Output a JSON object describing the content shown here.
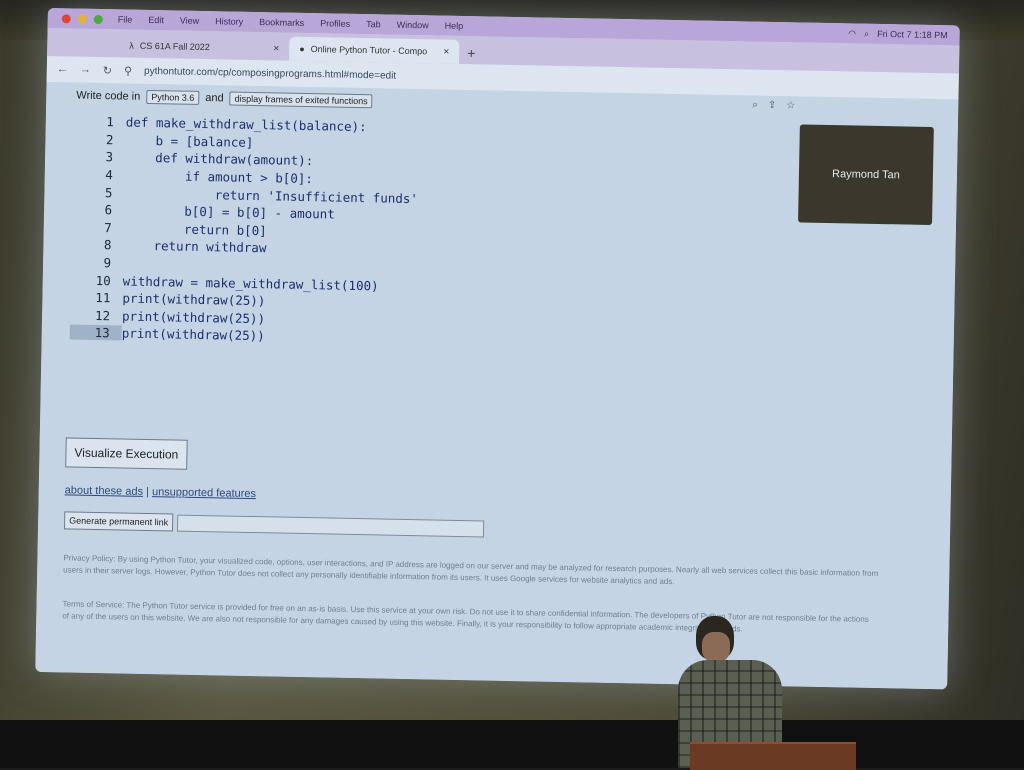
{
  "menubar": {
    "items": [
      "File",
      "Edit",
      "View",
      "History",
      "Bookmarks",
      "Profiles",
      "Tab",
      "Window",
      "Help"
    ],
    "clock": "Fri Oct 7 1:18 PM"
  },
  "tabs": [
    {
      "icon": "lambda-icon",
      "label": "CS 61A Fall 2022"
    },
    {
      "icon": "python-icon",
      "label": "Online Python Tutor - Compo"
    }
  ],
  "address": {
    "url": "pythontutor.com/cp/composingprograms.html#mode=edit"
  },
  "options": {
    "write_label": "Write code in",
    "language": "Python 3.6",
    "and_label": "and",
    "frames": "display frames of exited functions"
  },
  "code": {
    "current_line": 13,
    "lines": [
      "def make_withdraw_list(balance):",
      "    b = [balance]",
      "    def withdraw(amount):",
      "        if amount > b[0]:",
      "            return 'Insufficient funds'",
      "        b[0] = b[0] - amount",
      "        return b[0]",
      "    return withdraw",
      "",
      "withdraw = make_withdraw_list(100)",
      "print(withdraw(25))",
      "print(withdraw(25))",
      "print(withdraw(25))"
    ]
  },
  "buttons": {
    "visualize": "Visualize Execution",
    "permanent_link": "Generate permanent link"
  },
  "links": {
    "ads": "about these ads",
    "separator": "|",
    "unsupported": "unsupported features"
  },
  "policy": {
    "privacy": "Privacy Policy: By using Python Tutor, your visualized code, options, user interactions, and IP address are logged on our server and may be analyzed for research purposes. Nearly all web services collect this basic information from users in their server logs. However, Python Tutor does not collect any personally identifiable information from its users. It uses Google services for website analytics and ads.",
    "terms": "Terms of Service: The Python Tutor service is provided for free on an as-is basis. Use this service at your own risk. Do not use it to share confidential information. The developers of Python Tutor are not responsible for the actions of any of the users on this website. We are also not responsible for any damages caused by using this website. Finally, it is your responsibility to follow appropriate academic integrity standards."
  },
  "video": {
    "participant": "Raymond Tan"
  },
  "colors": {
    "accent_menubar": "#b9a6d8",
    "page_bg": "#c4d4e4",
    "keyword": "#1b2f6b"
  }
}
